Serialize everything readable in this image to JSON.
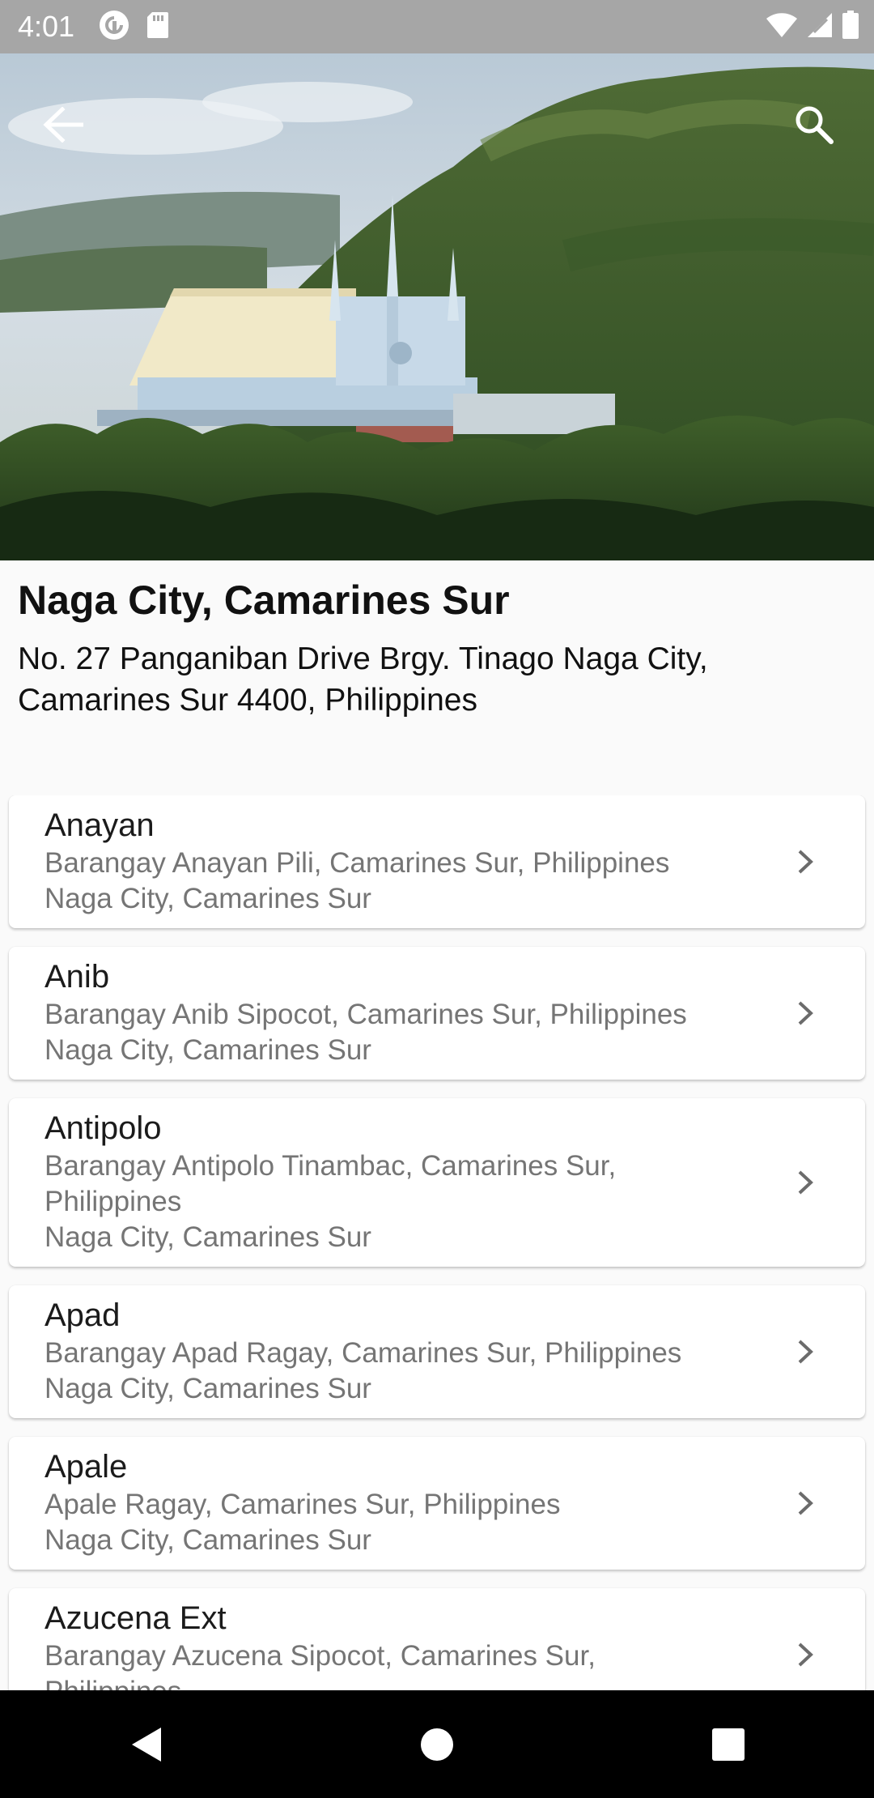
{
  "status_bar": {
    "time": "4:01",
    "left_icons": [
      "pocket-casts-icon",
      "sd-card-icon"
    ],
    "right_icons": [
      "wifi-icon",
      "cellular-signal-icon",
      "battery-icon"
    ]
  },
  "toolbar": {
    "back_icon": "arrow-back-icon",
    "search_icon": "search-icon"
  },
  "location": {
    "title": "Naga City, Camarines Sur",
    "address_line1": "No. 27 Panganiban Drive Brgy. Tinago Naga City,",
    "address_line2": "Camarines Sur 4400, Philippines"
  },
  "locales": [
    {
      "name": "Anayan",
      "lines": [
        "Barangay Anayan Pili, Camarines Sur, Philippines",
        "Naga City, Camarines Sur"
      ]
    },
    {
      "name": "Anib",
      "lines": [
        "Barangay Anib Sipocot, Camarines Sur, Philippines",
        "Naga City, Camarines Sur"
      ]
    },
    {
      "name": "Antipolo",
      "lines": [
        "Barangay Antipolo  Tinambac, Camarines Sur,",
        "Philippines",
        "Naga City, Camarines Sur"
      ]
    },
    {
      "name": "Apad",
      "lines": [
        "Barangay Apad Ragay, Camarines Sur, Philippines",
        "Naga City, Camarines Sur"
      ]
    },
    {
      "name": "Apale",
      "lines": [
        "Apale Ragay, Camarines Sur, Philippines",
        "Naga City, Camarines Sur"
      ]
    },
    {
      "name": "Azucena Ext",
      "lines": [
        "Barangay Azucena Sipocot, Camarines Sur,",
        "Philippines"
      ]
    }
  ],
  "nav_bar": {
    "back_icon": "nav-back-triangle-icon",
    "home_icon": "nav-home-circle-icon",
    "recents_icon": "nav-recents-square-icon"
  },
  "colors": {
    "status_bar": "#a6a6a6",
    "background": "#fafafa",
    "card": "#ffffff",
    "secondary_text": "#757575",
    "nav_bar": "#000000"
  }
}
